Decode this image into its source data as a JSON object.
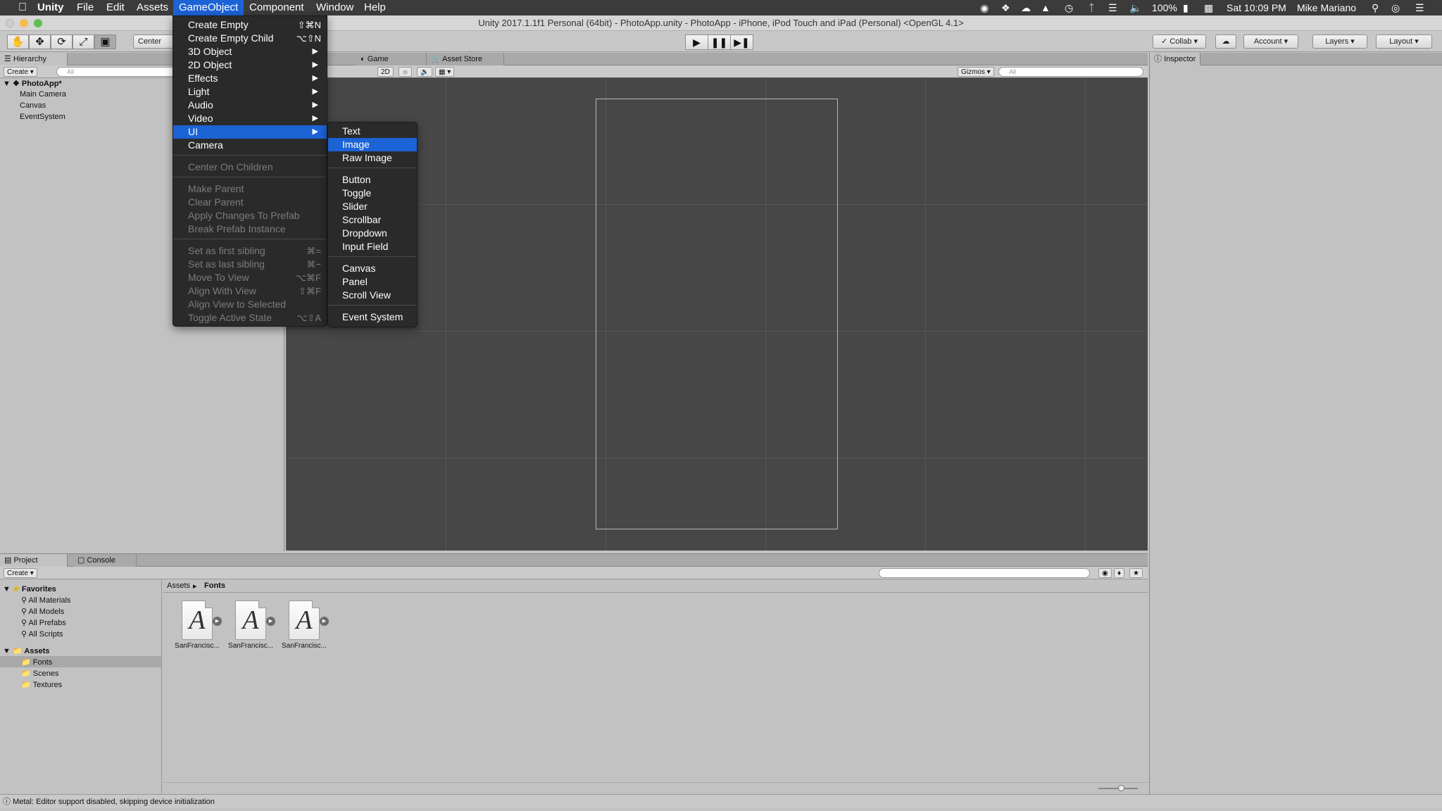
{
  "menubar": {
    "apple_icon": "apple-logo",
    "items": [
      "Unity",
      "File",
      "Edit",
      "Assets",
      "GameObject",
      "Component",
      "Window",
      "Help"
    ],
    "active_item": "GameObject",
    "status": {
      "battery": "100%",
      "clock": "Sat 10:09 PM",
      "user": "Mike Mariano"
    }
  },
  "window": {
    "title": "Unity 2017.1.1f1 Personal (64bit) - PhotoApp.unity - PhotoApp - iPhone, iPod Touch and iPad (Personal) <OpenGL 4.1>"
  },
  "toolbar": {
    "pivot_label": "Center",
    "collab_label": "Collab",
    "account_label": "Account",
    "layers_label": "Layers",
    "layout_label": "Layout"
  },
  "hierarchy": {
    "tab": "Hierarchy",
    "create": "Create",
    "search_placeholder": "All",
    "scene": "PhotoApp*",
    "items": [
      "Main Camera",
      "Canvas",
      "EventSystem"
    ]
  },
  "scene_view": {
    "tabs": [
      "Game",
      "Asset Store"
    ],
    "mode_2d": "2D",
    "gizmos": "Gizmos",
    "search_placeholder": "All"
  },
  "inspector": {
    "tab": "Inspector"
  },
  "gameobject_menu": {
    "items": [
      {
        "label": "Create Empty",
        "shortcut": "⇧⌘N"
      },
      {
        "label": "Create Empty Child",
        "shortcut": "⌥⇧N"
      },
      {
        "label": "3D Object",
        "submenu": true
      },
      {
        "label": "2D Object",
        "submenu": true
      },
      {
        "label": "Effects",
        "submenu": true
      },
      {
        "label": "Light",
        "submenu": true
      },
      {
        "label": "Audio",
        "submenu": true
      },
      {
        "label": "Video",
        "submenu": true
      },
      {
        "label": "UI",
        "submenu": true,
        "selected": true
      },
      {
        "label": "Camera"
      },
      {
        "label": "Center On Children",
        "disabled": true
      },
      {
        "label": "Make Parent",
        "disabled": true
      },
      {
        "label": "Clear Parent",
        "disabled": true
      },
      {
        "label": "Apply Changes To Prefab",
        "disabled": true
      },
      {
        "label": "Break Prefab Instance",
        "disabled": true
      },
      {
        "label": "Set as first sibling",
        "shortcut": "⌘=",
        "disabled": true
      },
      {
        "label": "Set as last sibling",
        "shortcut": "⌘−",
        "disabled": true
      },
      {
        "label": "Move To View",
        "shortcut": "⌥⌘F",
        "disabled": true
      },
      {
        "label": "Align With View",
        "shortcut": "⇧⌘F",
        "disabled": true
      },
      {
        "label": "Align View to Selected",
        "disabled": true
      },
      {
        "label": "Toggle Active State",
        "shortcut": "⌥⇧A",
        "disabled": true
      }
    ]
  },
  "ui_submenu": {
    "items": [
      {
        "label": "Text"
      },
      {
        "label": "Image",
        "selected": true
      },
      {
        "label": "Raw Image"
      },
      {
        "label": "Button"
      },
      {
        "label": "Toggle"
      },
      {
        "label": "Slider"
      },
      {
        "label": "Scrollbar"
      },
      {
        "label": "Dropdown"
      },
      {
        "label": "Input Field"
      },
      {
        "label": "Canvas"
      },
      {
        "label": "Panel"
      },
      {
        "label": "Scroll View"
      },
      {
        "label": "Event System"
      }
    ]
  },
  "project": {
    "tabs": [
      "Project",
      "Console"
    ],
    "create": "Create",
    "favorites_label": "Favorites",
    "favorites": [
      "All Materials",
      "All Models",
      "All Prefabs",
      "All Scripts"
    ],
    "assets_label": "Assets",
    "folders": [
      "Fonts",
      "Scenes",
      "Textures"
    ],
    "selected_folder": "Fonts",
    "breadcrumb": [
      "Assets",
      "Fonts"
    ],
    "files": [
      "SanFrancisc...",
      "SanFrancisc...",
      "SanFrancisc..."
    ]
  },
  "statusbar": {
    "message": "Metal: Editor support disabled, skipping device initialization"
  },
  "colors": {
    "accent": "#1c63d6",
    "menu_bg": "#2a2a2a",
    "scene_bg": "#474747"
  }
}
